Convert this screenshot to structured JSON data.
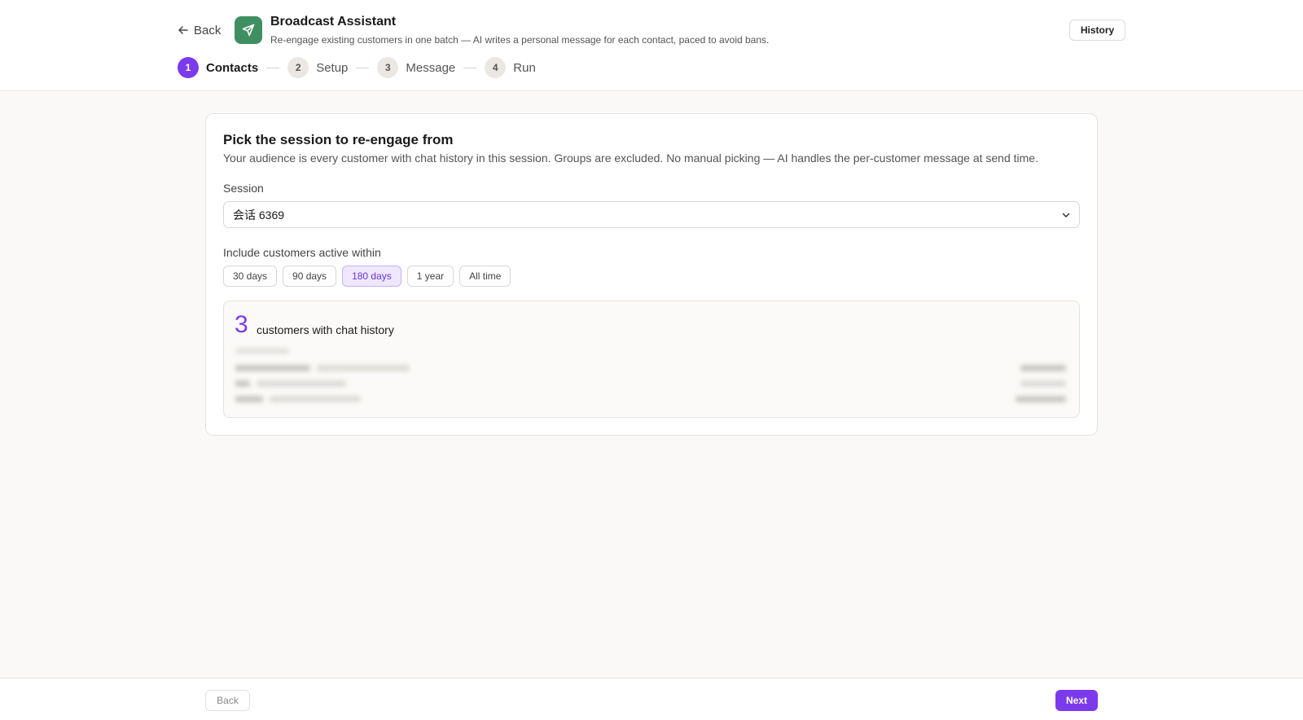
{
  "header": {
    "back_label": "Back",
    "title": "Broadcast Assistant",
    "subtitle": "Re-engage existing customers in one batch — AI writes a personal message for each contact, paced to avoid bans.",
    "history_label": "History",
    "app_icon": "send-icon",
    "accent_color": "#3f8f62"
  },
  "stepper": {
    "steps": [
      {
        "number": "1",
        "label": "Contacts",
        "active": true
      },
      {
        "number": "2",
        "label": "Setup",
        "active": false
      },
      {
        "number": "3",
        "label": "Message",
        "active": false
      },
      {
        "number": "4",
        "label": "Run",
        "active": false
      }
    ],
    "active_color": "#7c3aed"
  },
  "card": {
    "title": "Pick the session to re-engage from",
    "description": "Your audience is every customer with chat history in this session. Groups are excluded. No manual picking — AI handles the per-customer message at send time.",
    "session_label": "Session",
    "session_value": "会话 6369",
    "activity_label": "Include customers active within",
    "activity_options": [
      "30 days",
      "90 days",
      "180 days",
      "1 year",
      "All time"
    ],
    "activity_selected": "180 days",
    "summary": {
      "count": "3",
      "count_label": "customers with chat history"
    }
  },
  "footer": {
    "back_label": "Back",
    "next_label": "Next"
  }
}
